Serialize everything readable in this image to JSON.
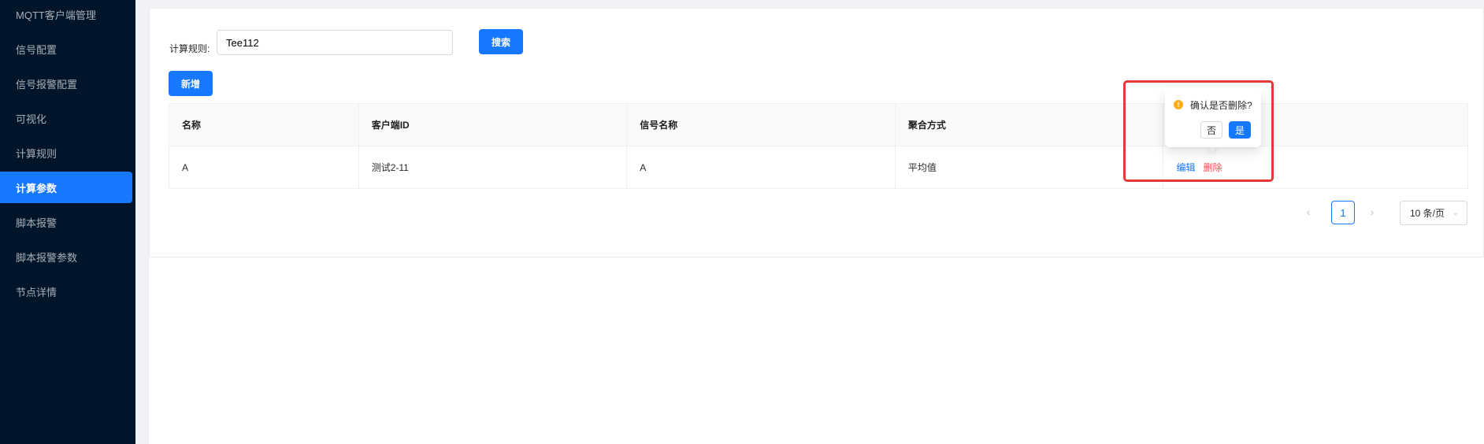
{
  "sidebar": {
    "items": [
      {
        "label": "MQTT客户端管理"
      },
      {
        "label": "信号配置"
      },
      {
        "label": "信号报警配置"
      },
      {
        "label": "可视化"
      },
      {
        "label": "计算规则"
      },
      {
        "label": "计算参数"
      },
      {
        "label": "脚本报警"
      },
      {
        "label": "脚本报警参数"
      },
      {
        "label": "节点详情"
      }
    ],
    "active_index": 5
  },
  "search": {
    "label": "计算规则:",
    "value": "Tee112",
    "button": "搜索"
  },
  "toolbar": {
    "add_label": "新增"
  },
  "table": {
    "columns": [
      "名称",
      "客户端ID",
      "信号名称",
      "聚合方式",
      ""
    ],
    "rows": [
      {
        "name": "A",
        "client_id": "测试2-11",
        "signal": "A",
        "agg": "平均值",
        "edit": "编辑",
        "delete": "删除"
      }
    ]
  },
  "pagination": {
    "prev": "‹",
    "current": "1",
    "next": "›",
    "page_size": "10 条/页"
  },
  "popconfirm": {
    "title": "确认是否删除?",
    "no": "否",
    "yes": "是"
  },
  "colors": {
    "sidebar_bg": "#001529",
    "primary": "#1677ff",
    "danger": "#ff4d4f",
    "warning": "#faad14",
    "highlight": "#e53935"
  }
}
